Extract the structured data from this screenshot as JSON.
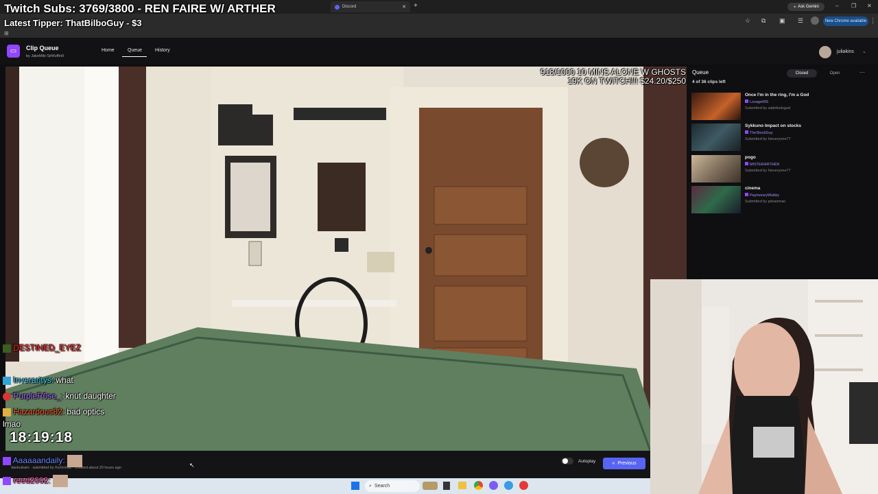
{
  "overlay": {
    "subs_line": "Twitch Subs: 3769/3800 - REN FAIRE W/ ARTHER",
    "tipper_line": "Latest Tipper: ThatBilboGuy - $3",
    "goal_line1": "918/1000 10 MINS ALONE W GHOSTS",
    "goal_line2": "19K ON TWITCH!!! $24.20/$250",
    "timer": "18:19:18"
  },
  "browser": {
    "tabs": [
      {
        "label": "Discord"
      }
    ],
    "ask_gemini": "Ask Gemini",
    "new_chrome": "New Chrome available"
  },
  "app": {
    "title": "Clip Queue",
    "by": "by",
    "creators": [
      "JakeMiki",
      "SirMuffin9"
    ],
    "nav": [
      "Home",
      "Queue",
      "History"
    ],
    "user": "juliakins"
  },
  "queue": {
    "heading": "Queue",
    "count": "4 of 36 clips left",
    "closed": "Closed",
    "open": "Open",
    "clips": [
      {
        "title": "Once I'm in the ring, I'm a God",
        "channel": "Lovage005",
        "submitted": "Submitted by satinfeelsgud"
      },
      {
        "title": "Sykkuno Impact on stocks",
        "channel": "TheStockGuy",
        "submitted": "Submitted by hieveryone77"
      },
      {
        "title": "pogo",
        "channel": "MISTERARTHER",
        "submitted": "Submitted by hieveryone77"
      },
      {
        "title": "cinema",
        "channel": "PaymoneyWubby",
        "submitted": "Submitted by pdxairman"
      }
    ]
  },
  "chat": [
    {
      "user": "DESTINED_EYEZ",
      "msg": "",
      "color": "#ff2a2a"
    },
    {
      "user": "Inveraritys:",
      "msg": "what",
      "color": "#3fd3ff"
    },
    {
      "user": "PurpleR0se_:",
      "msg": "knut daughter",
      "color": "#b06bff"
    },
    {
      "user": "Hazardous82:",
      "msg": "bad optics",
      "color": "#ff5a2a"
    },
    {
      "user": "",
      "msg": "lmao",
      "color": "#ffffff"
    },
    {
      "user": "Aaaaaandaily:",
      "msg": "",
      "color": "#6a8cff"
    },
    {
      "user": "reed2002:",
      "msg": "",
      "color": "#ff4aa0"
    }
  ],
  "player": {
    "meta": "danloskam · submitted by KaTerinac · created about 20 hours ago",
    "autoplay": "Autoplay",
    "previous": "Previous"
  },
  "taskbar": {
    "search": "Search"
  },
  "colors": {
    "accent": "#5865f2",
    "brand": "#9146ff"
  }
}
